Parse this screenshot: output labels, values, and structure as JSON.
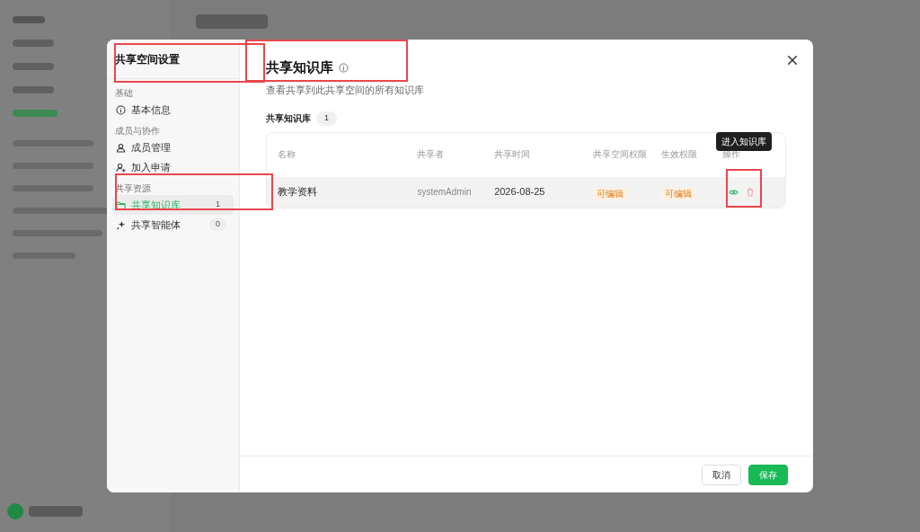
{
  "dialog": {
    "title": "共享空间设置",
    "nav": [
      {
        "heading": "基础",
        "items": [
          {
            "label": "基本信息",
            "selected": false
          }
        ]
      },
      {
        "heading": "成员与协作",
        "items": [
          {
            "label": "成员管理",
            "selected": false
          },
          {
            "label": "加入申请",
            "selected": false
          }
        ]
      },
      {
        "heading": "共享资源",
        "items": [
          {
            "label": "共享知识库",
            "count": "1",
            "selected": true
          },
          {
            "label": "共享智能体",
            "count": "0",
            "selected": false
          }
        ]
      }
    ],
    "content": {
      "title": "共享知识库",
      "subtitle": "查看共享到此共享空间的所有知识库",
      "section_label": "共享知识库",
      "section_count": "1",
      "table": {
        "columns": [
          "名称",
          "共享者",
          "共享时间",
          "共享空间权限",
          "生效权限",
          "操作"
        ],
        "rows": [
          {
            "name": "教学资料",
            "sharer": "systemAdmin",
            "time": "2026-08-25",
            "space_permission": "可编辑",
            "effective_permission": "可编辑"
          }
        ]
      },
      "tooltip": "进入知识库"
    },
    "buttons": [
      {
        "label": "取消",
        "kind": "secondary"
      },
      {
        "label": "保存",
        "kind": "primary"
      }
    ]
  }
}
